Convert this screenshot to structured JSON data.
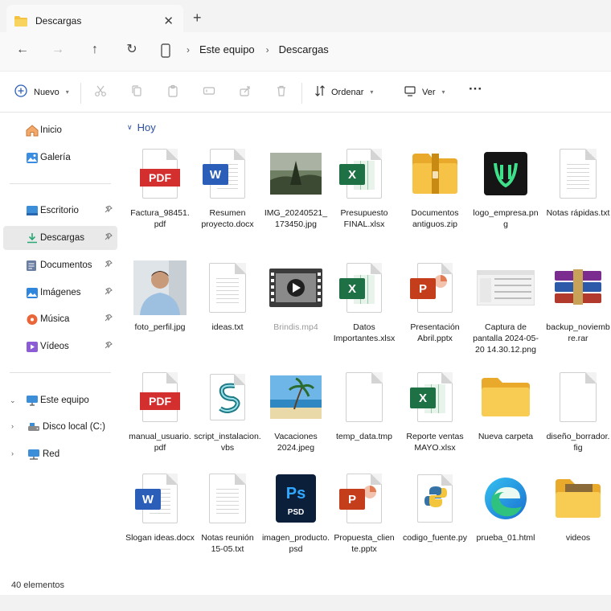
{
  "window": {
    "tab_title": "Descargas",
    "close_glyph": "✕",
    "new_tab_glyph": "+"
  },
  "navigation": {
    "back_glyph": "←",
    "forward_glyph": "→",
    "up_glyph": "↑",
    "refresh_glyph": "↻",
    "breadcrumbs": [
      "Este equipo",
      "Descargas"
    ],
    "separator_glyph": "›"
  },
  "toolbar": {
    "new_label": "Nuevo",
    "sort_label": "Ordenar",
    "view_label": "Ver",
    "more_glyph": "···"
  },
  "sidebar": {
    "items": [
      {
        "label": "Inicio",
        "icon": "home-icon"
      },
      {
        "label": "Galería",
        "icon": "gallery-icon"
      },
      {
        "label": "Escritorio",
        "icon": "desktop-icon",
        "pinned": true
      },
      {
        "label": "Descargas",
        "icon": "download-icon",
        "pinned": true,
        "active": true
      },
      {
        "label": "Documentos",
        "icon": "documents-icon",
        "pinned": true
      },
      {
        "label": "Imágenes",
        "icon": "pictures-icon",
        "pinned": true
      },
      {
        "label": "Música",
        "icon": "music-icon",
        "pinned": true
      },
      {
        "label": "Vídeos",
        "icon": "videos-icon",
        "pinned": true
      }
    ],
    "tree": [
      {
        "label": "Este equipo",
        "icon": "this-pc-icon",
        "expanded": true
      },
      {
        "label": "Disco local (C:)",
        "icon": "drive-icon"
      },
      {
        "label": "Red",
        "icon": "network-icon"
      }
    ],
    "pin_glyph": "📌"
  },
  "main": {
    "group_label": "Hoy",
    "files": [
      {
        "name": "Factura_98451.\npdf",
        "type": "pdf"
      },
      {
        "name": "Resumen\nproyecto.docx",
        "type": "word"
      },
      {
        "name": "IMG_20240521_\n173450.jpg",
        "type": "photo-forest"
      },
      {
        "name": "Presupuesto\nFINAL.xlsx",
        "type": "excel"
      },
      {
        "name": "Documentos\nantiguos.zip",
        "type": "zip"
      },
      {
        "name": "logo_empresa.png",
        "type": "logo"
      },
      {
        "name": "Notas rápidas.txt",
        "type": "txt"
      },
      {
        "name": "foto_perfil.jpg",
        "type": "photo-person"
      },
      {
        "name": "ideas.txt",
        "type": "txt"
      },
      {
        "name": "Brindis.mp4",
        "type": "video",
        "dim": true
      },
      {
        "name": "Datos\nImportantes.xlsx",
        "type": "excel"
      },
      {
        "name": "Presentación\nAbril.pptx",
        "type": "ppt"
      },
      {
        "name": "Captura de\npantalla 2024-05-\n20 14.30.12.png",
        "type": "screenshot"
      },
      {
        "name": "backup_noviemb\nre.rar",
        "type": "rar"
      },
      {
        "name": "manual_usuario.\npdf",
        "type": "pdf"
      },
      {
        "name": "script_instalacion.\nvbs",
        "type": "vbs"
      },
      {
        "name": "Vacaciones\n2024.jpeg",
        "type": "photo-beach"
      },
      {
        "name": "temp_data.tmp",
        "type": "blank"
      },
      {
        "name": "Reporte ventas\nMAYO.xlsx",
        "type": "excel"
      },
      {
        "name": "Nueva carpeta",
        "type": "folder"
      },
      {
        "name": "diseño_borrador.\nfig",
        "type": "blank"
      },
      {
        "name": "Slogan ideas.docx",
        "type": "word"
      },
      {
        "name": "Notas reunión\n15-05.txt",
        "type": "txt"
      },
      {
        "name": "imagen_producto.\npsd",
        "type": "psd"
      },
      {
        "name": "Propuesta_clien\nte.pptx",
        "type": "ppt"
      },
      {
        "name": "codigo_fuente.py",
        "type": "python"
      },
      {
        "name": "prueba_01.html",
        "type": "edge"
      },
      {
        "name": "videos",
        "type": "folder-video"
      }
    ]
  },
  "status": {
    "item_count": "40 elementos"
  },
  "colors": {
    "accent": "#2b4fa3",
    "pdf_red": "#d32f2f",
    "word_blue": "#2b5eb8",
    "excel_green": "#1e7145",
    "ppt_orange": "#c43e1c",
    "folder_yellow": "#f4c242"
  }
}
